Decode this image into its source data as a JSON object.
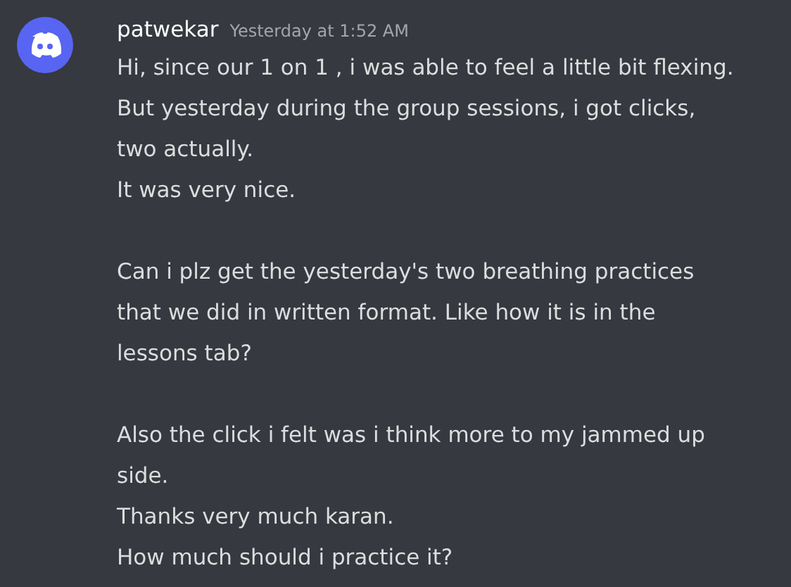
{
  "message": {
    "author": "patwekar",
    "timestamp": "Yesterday at 1:52 AM",
    "paragraphs": [
      [
        "Hi, since our 1 on 1 , i was able to feel a little bit flexing.",
        "But yesterday during the group sessions, i got clicks,",
        "two actually.",
        "It was very nice."
      ],
      [
        "Can i plz get the yesterday's two breathing practices",
        "that we did in written format. Like how it is in the",
        "lessons tab?"
      ],
      [
        "Also the click i felt was i think more to my jammed up",
        "side.",
        "Thanks very much karan.",
        "How much should i practice it?"
      ]
    ]
  }
}
